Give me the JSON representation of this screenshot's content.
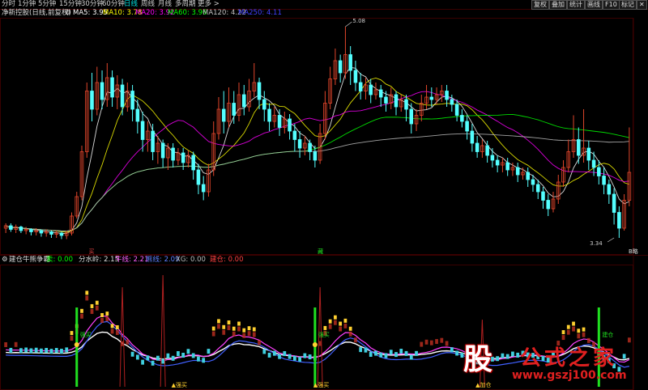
{
  "toolbar": {
    "periods": [
      "分时",
      "1分钟",
      "5分钟",
      "15分钟",
      "30分钟",
      "60分钟",
      "日线",
      "周线",
      "月线",
      "多周期",
      "更多 >"
    ],
    "active_period": "日线",
    "right_buttons": [
      "复权",
      "叠加",
      "统计",
      "画线",
      "F10",
      "标记"
    ]
  },
  "main_info": {
    "title": "净新控股(日线,前复权)",
    "ma5": "MA5: 3.95",
    "ma10": "MA10: 3.78",
    "ma20": "MA20: 3.92",
    "ma60": "MA60: 3.96",
    "ma120": "MA120: 4.22",
    "ma250": "MA250: 4.11"
  },
  "sub_info": {
    "title": "建仓牛熊争霸",
    "sell": "卖: 0.00",
    "water": "分水岭: 2.15",
    "bull": "牛线: 2.21",
    "bear": "熊线: 2.09",
    "xg": "XG: 0.00",
    "jiancang": "建仓: 0.00"
  },
  "annotations": {
    "high": "5.08",
    "low": "3.34",
    "marker_buy": "买",
    "marker_mid": "藏",
    "marker_right": "B略",
    "label_zhuangzhi": "强买",
    "label_jiancang": "建仓",
    "label_zhu": "加仓"
  },
  "brand": {
    "logo_char": "股",
    "name": "公式之家",
    "url": "www.gszj100.com"
  },
  "colors": {
    "up": "#e0452b",
    "down": "#54ffff",
    "ma5": "#ffffff",
    "ma10": "#ffff00",
    "ma20": "#ff00ff",
    "ma60": "#00ff00",
    "ma120": "#c0c0c0",
    "ma250": "#4040ff",
    "grid": "#3a0000",
    "spike": "#b02020",
    "xg_bar": "#20e020"
  },
  "chart_data": {
    "type": "candlestick",
    "price_range": [
      3.3,
      5.1
    ],
    "candles": [
      [
        3.42,
        3.44,
        3.38,
        3.46
      ],
      [
        3.44,
        3.41,
        3.39,
        3.46
      ],
      [
        3.41,
        3.43,
        3.38,
        3.45
      ],
      [
        3.43,
        3.4,
        3.38,
        3.44
      ],
      [
        3.4,
        3.41,
        3.37,
        3.43
      ],
      [
        3.41,
        3.39,
        3.36,
        3.42
      ],
      [
        3.39,
        3.4,
        3.36,
        3.42
      ],
      [
        3.4,
        3.38,
        3.35,
        3.41
      ],
      [
        3.38,
        3.39,
        3.35,
        3.41
      ],
      [
        3.39,
        3.37,
        3.34,
        3.4
      ],
      [
        3.37,
        3.38,
        3.34,
        3.4
      ],
      [
        3.38,
        3.36,
        3.33,
        3.39
      ],
      [
        3.36,
        3.38,
        3.33,
        3.4
      ],
      [
        3.38,
        3.52,
        3.36,
        3.55
      ],
      [
        3.52,
        3.68,
        3.5,
        3.72
      ],
      [
        3.68,
        4.05,
        3.65,
        4.1
      ],
      [
        4.05,
        4.55,
        4.0,
        4.62
      ],
      [
        4.55,
        4.4,
        4.3,
        4.7
      ],
      [
        4.4,
        4.62,
        4.35,
        4.75
      ],
      [
        4.62,
        4.48,
        4.4,
        4.72
      ],
      [
        4.48,
        4.66,
        4.42,
        4.78
      ],
      [
        4.66,
        4.5,
        4.42,
        4.72
      ],
      [
        4.5,
        4.6,
        4.4,
        4.68
      ],
      [
        4.6,
        4.42,
        4.35,
        4.65
      ],
      [
        4.42,
        4.55,
        4.38,
        4.62
      ],
      [
        4.55,
        4.4,
        4.3,
        4.6
      ],
      [
        4.4,
        4.3,
        4.2,
        4.48
      ],
      [
        4.3,
        4.15,
        4.05,
        4.38
      ],
      [
        4.15,
        4.22,
        4.05,
        4.3
      ],
      [
        4.22,
        4.05,
        3.98,
        4.28
      ],
      [
        4.05,
        4.12,
        3.95,
        4.18
      ],
      [
        4.12,
        4.0,
        3.92,
        4.15
      ],
      [
        4.0,
        4.08,
        3.9,
        4.12
      ],
      [
        4.08,
        3.98,
        3.92,
        4.12
      ],
      [
        3.98,
        4.04,
        3.94,
        4.08
      ],
      [
        4.04,
        3.96,
        3.9,
        4.08
      ],
      [
        3.96,
        4.02,
        3.92,
        4.06
      ],
      [
        4.02,
        3.9,
        3.82,
        4.05
      ],
      [
        3.9,
        3.78,
        3.7,
        3.95
      ],
      [
        3.78,
        3.72,
        3.65,
        3.85
      ],
      [
        3.72,
        3.9,
        3.68,
        3.95
      ],
      [
        3.9,
        4.2,
        3.85,
        4.3
      ],
      [
        4.2,
        4.4,
        4.15,
        4.5
      ],
      [
        4.4,
        4.3,
        4.2,
        4.55
      ],
      [
        4.3,
        4.45,
        4.25,
        4.58
      ],
      [
        4.45,
        4.35,
        4.28,
        4.55
      ],
      [
        4.35,
        4.52,
        4.3,
        4.62
      ],
      [
        4.52,
        4.42,
        4.35,
        4.6
      ],
      [
        4.42,
        4.55,
        4.38,
        4.65
      ],
      [
        4.55,
        4.62,
        4.5,
        4.78
      ],
      [
        4.62,
        4.48,
        4.4,
        4.66
      ],
      [
        4.48,
        4.4,
        4.3,
        4.55
      ],
      [
        4.4,
        4.3,
        4.22,
        4.45
      ],
      [
        4.3,
        4.35,
        4.25,
        4.42
      ],
      [
        4.35,
        4.25,
        4.18,
        4.4
      ],
      [
        4.25,
        4.32,
        4.2,
        4.38
      ],
      [
        4.32,
        4.22,
        4.15,
        4.36
      ],
      [
        4.22,
        4.15,
        4.05,
        4.28
      ],
      [
        4.15,
        4.08,
        4.0,
        4.22
      ],
      [
        4.08,
        4.12,
        4.02,
        4.18
      ],
      [
        4.12,
        4.05,
        3.98,
        4.15
      ],
      [
        4.05,
        3.98,
        3.92,
        4.1
      ],
      [
        3.98,
        4.2,
        3.95,
        4.28
      ],
      [
        4.2,
        4.45,
        4.15,
        4.55
      ],
      [
        4.45,
        4.65,
        4.4,
        4.75
      ],
      [
        4.65,
        4.8,
        4.6,
        4.9
      ],
      [
        4.8,
        4.7,
        4.62,
        4.85
      ],
      [
        4.7,
        4.85,
        4.65,
        5.08
      ],
      [
        4.85,
        4.72,
        4.6,
        4.92
      ],
      [
        4.72,
        4.62,
        4.55,
        4.8
      ],
      [
        4.62,
        4.55,
        4.48,
        4.7
      ],
      [
        4.55,
        4.6,
        4.48,
        4.66
      ],
      [
        4.6,
        4.52,
        4.45,
        4.65
      ],
      [
        4.52,
        4.56,
        4.48,
        4.62
      ],
      [
        4.56,
        4.5,
        4.42,
        4.6
      ],
      [
        4.5,
        4.45,
        4.38,
        4.55
      ],
      [
        4.45,
        4.52,
        4.4,
        4.58
      ],
      [
        4.52,
        4.42,
        4.35,
        4.55
      ],
      [
        4.42,
        4.48,
        4.38,
        4.52
      ],
      [
        4.48,
        4.4,
        4.3,
        4.52
      ],
      [
        4.4,
        4.28,
        4.2,
        4.45
      ],
      [
        4.28,
        4.35,
        4.22,
        4.4
      ],
      [
        4.35,
        4.45,
        4.3,
        4.52
      ],
      [
        4.45,
        4.5,
        4.4,
        4.6
      ],
      [
        4.5,
        4.48,
        4.42,
        4.58
      ],
      [
        4.48,
        4.52,
        4.44,
        4.58
      ],
      [
        4.52,
        4.55,
        4.46,
        4.6
      ],
      [
        4.55,
        4.48,
        4.42,
        4.6
      ],
      [
        4.48,
        4.44,
        4.38,
        4.52
      ],
      [
        4.44,
        4.35,
        4.3,
        4.48
      ],
      [
        4.35,
        4.3,
        4.25,
        4.4
      ],
      [
        4.3,
        4.22,
        4.15,
        4.35
      ],
      [
        4.22,
        4.12,
        4.05,
        4.28
      ],
      [
        4.12,
        4.05,
        4.0,
        4.18
      ],
      [
        4.05,
        4.1,
        4.0,
        4.15
      ],
      [
        4.1,
        4.02,
        3.96,
        4.14
      ],
      [
        4.02,
        3.98,
        3.92,
        4.08
      ],
      [
        3.98,
        3.94,
        3.88,
        4.02
      ],
      [
        3.94,
        3.96,
        3.88,
        4.0
      ],
      [
        3.96,
        3.9,
        3.85,
        4.0
      ],
      [
        3.9,
        3.92,
        3.85,
        3.96
      ],
      [
        3.92,
        3.86,
        3.8,
        3.96
      ],
      [
        3.86,
        3.88,
        3.82,
        3.92
      ],
      [
        3.88,
        3.82,
        3.76,
        3.92
      ],
      [
        3.82,
        3.78,
        3.72,
        3.86
      ],
      [
        3.78,
        3.72,
        3.66,
        3.82
      ],
      [
        3.72,
        3.65,
        3.58,
        3.76
      ],
      [
        3.65,
        3.58,
        3.52,
        3.7
      ],
      [
        3.58,
        3.66,
        3.55,
        3.72
      ],
      [
        3.66,
        3.8,
        3.62,
        3.86
      ],
      [
        3.8,
        3.92,
        3.76,
        3.98
      ],
      [
        3.92,
        4.05,
        3.88,
        4.15
      ],
      [
        4.05,
        4.15,
        4.0,
        4.35
      ],
      [
        4.15,
        4.02,
        3.95,
        4.25
      ],
      [
        4.02,
        4.08,
        3.96,
        4.4
      ],
      [
        4.08,
        3.98,
        3.9,
        4.14
      ],
      [
        3.98,
        3.92,
        3.85,
        4.05
      ],
      [
        3.92,
        3.85,
        3.78,
        3.98
      ],
      [
        3.85,
        3.78,
        3.7,
        3.92
      ],
      [
        3.78,
        3.7,
        3.62,
        3.82
      ],
      [
        3.7,
        3.55,
        3.45,
        3.75
      ],
      [
        3.55,
        3.42,
        3.34,
        3.6
      ],
      [
        3.42,
        3.65,
        3.4,
        3.7
      ],
      [
        3.65,
        3.88,
        3.6,
        4.25
      ]
    ]
  }
}
